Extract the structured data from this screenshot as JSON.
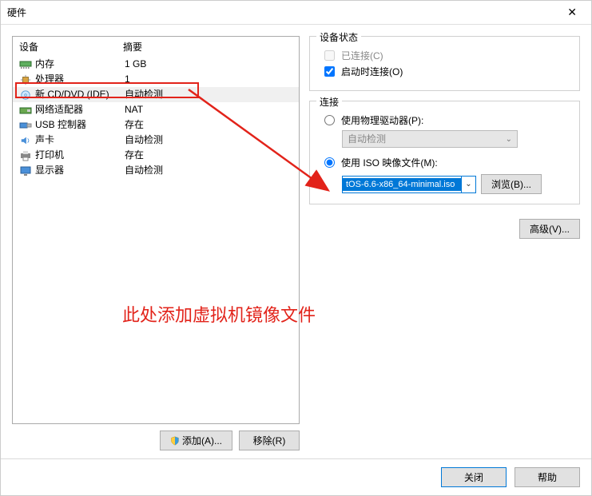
{
  "window": {
    "title": "硬件"
  },
  "left": {
    "headers": {
      "device": "设备",
      "summary": "摘要"
    },
    "rows": [
      {
        "name": "内存",
        "summary": "1 GB",
        "icon": "memory"
      },
      {
        "name": "处理器",
        "summary": "1",
        "icon": "cpu"
      },
      {
        "name": "新 CD/DVD (IDE)",
        "summary": "自动检测",
        "icon": "disc",
        "selected": true,
        "hilite": true
      },
      {
        "name": "网络适配器",
        "summary": "NAT",
        "icon": "nic"
      },
      {
        "name": "USB 控制器",
        "summary": "存在",
        "icon": "usb"
      },
      {
        "name": "声卡",
        "summary": "自动检测",
        "icon": "audio"
      },
      {
        "name": "打印机",
        "summary": "存在",
        "icon": "printer"
      },
      {
        "name": "显示器",
        "summary": "自动检测",
        "icon": "display"
      }
    ],
    "add_btn": "添加(A)...",
    "remove_btn": "移除(R)"
  },
  "status_group": {
    "title": "设备状态",
    "connected": "已连接(C)",
    "connect_on": "启动时连接(O)"
  },
  "connect_group": {
    "title": "连接",
    "physical": "使用物理驱动器(P):",
    "auto_detect": "自动检测",
    "iso": "使用 ISO 映像文件(M):",
    "iso_value": "tOS-6.6-x86_64-minimal.iso",
    "browse": "浏览(B)..."
  },
  "advanced_btn": "高级(V)...",
  "annotation": "此处添加虚拟机镜像文件",
  "footer": {
    "close": "关闭",
    "help": "帮助"
  }
}
